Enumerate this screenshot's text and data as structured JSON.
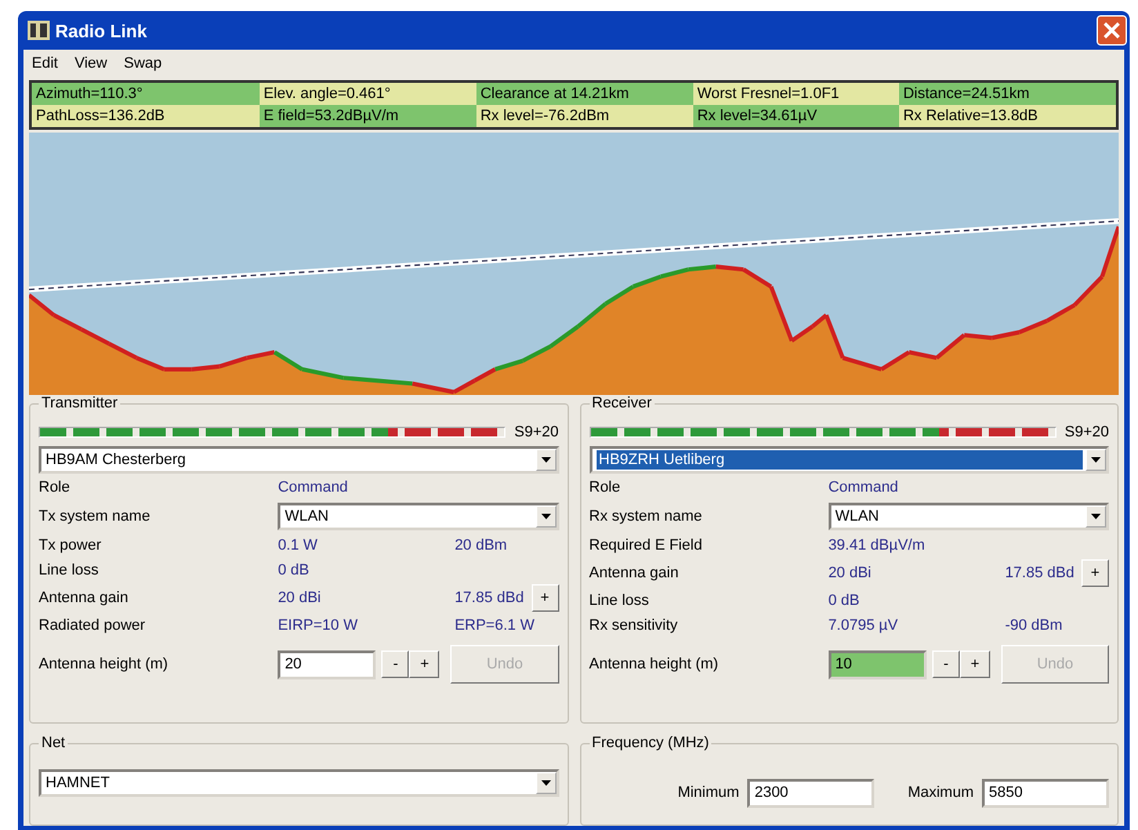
{
  "window": {
    "title": "Radio Link"
  },
  "menu": [
    "Edit",
    "View",
    "Swap"
  ],
  "info_bar": {
    "rows": [
      {
        "cells": [
          "Azimuth=110.3°",
          "Elev. angle=0.461°",
          "Clearance at 14.21km",
          "Worst Fresnel=1.0F1",
          "Distance=24.51km"
        ]
      },
      {
        "cells": [
          "PathLoss=136.2dB",
          "E field=53.2dBµV/m",
          "Rx level=-76.2dBm",
          "Rx level=34.61µV",
          "Rx Relative=13.8dB"
        ]
      }
    ]
  },
  "transmitter": {
    "title": "Transmitter",
    "meter": {
      "level": 1,
      "reading": "S9+20"
    },
    "station": {
      "value": "HB9AM Chesterberg",
      "selected": false
    },
    "rows": [
      {
        "kind": "text",
        "label": "Role",
        "value": "Command"
      },
      {
        "kind": "select",
        "label": "Tx system name",
        "value": "WLAN"
      },
      {
        "kind": "text",
        "label": "Tx power",
        "value": "0.1 W",
        "value2": "20 dBm"
      },
      {
        "kind": "text",
        "label": "Line loss",
        "value": "0 dB"
      },
      {
        "kind": "text",
        "label": "Antenna gain",
        "value": "20 dBi",
        "value2": "17.85 dBd",
        "button": "+"
      },
      {
        "kind": "text",
        "label": "Radiated power",
        "value": "EIRP=10 W",
        "value2": "ERP=6.1 W"
      }
    ],
    "antenna_height": {
      "label": "Antenna height (m)",
      "value": "20",
      "highlighted": false,
      "buttons": [
        "-",
        "+"
      ],
      "undo": {
        "label": "Undo",
        "disabled": true
      }
    }
  },
  "receiver": {
    "title": "Receiver",
    "meter": {
      "level": 1,
      "reading": "S9+20"
    },
    "station": {
      "value": "HB9ZRH Uetliberg",
      "selected": true
    },
    "rows": [
      {
        "kind": "text",
        "label": "Role",
        "value": "Command"
      },
      {
        "kind": "select",
        "label": "Rx system name",
        "value": "WLAN"
      },
      {
        "kind": "text",
        "label": "Required E Field",
        "value": "39.41 dBµV/m"
      },
      {
        "kind": "text",
        "label": "Antenna gain",
        "value": "20 dBi",
        "value2": "17.85 dBd",
        "button": "+"
      },
      {
        "kind": "text",
        "label": "Line loss",
        "value": "0 dB"
      },
      {
        "kind": "text",
        "label": "Rx sensitivity",
        "value": "7.0795 µV",
        "value2": "-90 dBm"
      }
    ],
    "antenna_height": {
      "label": "Antenna height (m)",
      "value": "10",
      "highlighted": true,
      "buttons": [
        "-",
        "+"
      ],
      "undo": {
        "label": "Undo",
        "disabled": true
      }
    }
  },
  "net": {
    "title": "Net",
    "value": "HAMNET"
  },
  "frequency": {
    "title": "Frequency (MHz)",
    "fields": [
      {
        "label": "Minimum",
        "value": "2300"
      },
      {
        "label": "Maximum",
        "value": "5850"
      }
    ]
  }
}
